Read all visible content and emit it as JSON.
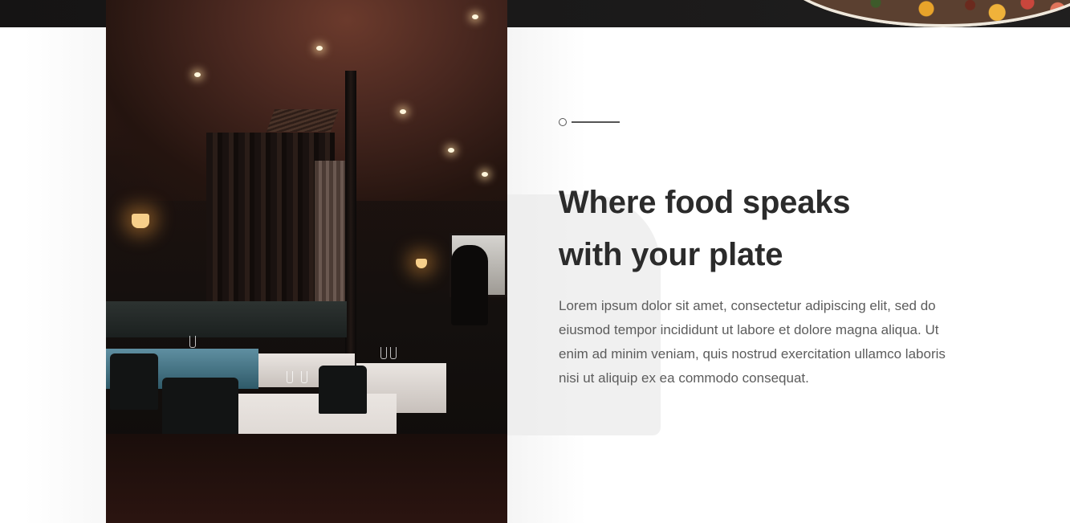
{
  "hero": {
    "headline_line1": "Where food speaks",
    "headline_line2": "with your plate",
    "body": "Lorem ipsum dolor sit amet, consectetur adipiscing elit, sed do eiusmod tempor incididunt ut labore et dolore magna aliqua. Ut enim ad minim veniam, quis nostrud exercitation ullamco laboris nisi ut aliquip ex ea commodo consequat."
  },
  "images": {
    "restaurant": "restaurant-interior-photo",
    "top_banner": "salad-bowl-photo"
  },
  "colors": {
    "heading": "#2b2b2b",
    "body_text": "#5c5c5c",
    "top_band": "#151414",
    "deco_block": "#ebebeb"
  }
}
